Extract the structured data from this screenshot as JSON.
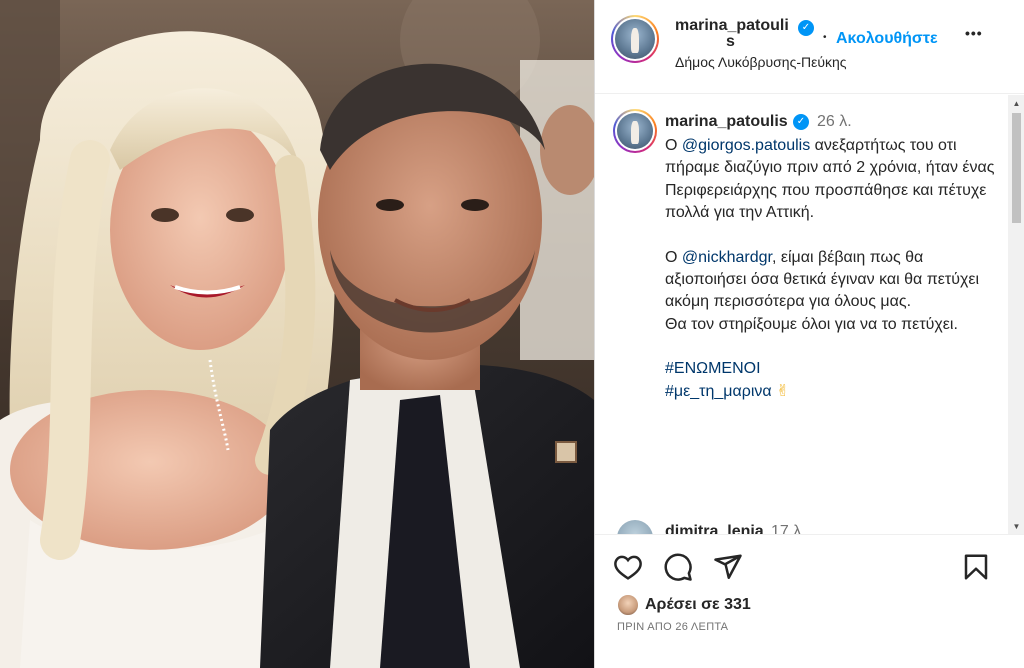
{
  "post": {
    "username": "marina_patoulis",
    "username_line1": "marina_patouli",
    "username_line2": "s",
    "verified_icon": "verified-badge-icon",
    "follow_label": "Ακολουθήστε",
    "separator": "•",
    "more_label": "•••",
    "location": "Δήμος Λυκόβρυσης-Πεύκης"
  },
  "caption": {
    "username": "marina_patoulis",
    "time": "26 λ.",
    "para1_prefix": "Ο ",
    "para1_mention": "@giorgos.patoulis",
    "para1_rest": " ανεξαρτήτως του οτι πήραμε διαζύγιο πριν από 2 χρόνια, ήταν ένας Περιφερειάρχης που προσπάθησε και πέτυχε πολλά για την Αττική.",
    "para2_prefix": "Ο ",
    "para2_mention": "@nickhardgr",
    "para2_rest": ", είμαι βέβαιη πως θα αξιοποιήσει όσα θετικά έγιναν και θα πετύχει ακόμη περισσότερα για όλους μας.",
    "para2_line2": "Θα τον στηρίξουμε όλοι για να το πετύχει.",
    "hashtag1": "#ΕΝΩΜΕΝΟΙ",
    "hashtag2": "#με_τη_μαρινα",
    "emoji": "✌"
  },
  "next_comment": {
    "username": "dimitra_lenia",
    "time": "17 λ."
  },
  "actions": {
    "like_icon": "heart-icon",
    "comment_icon": "comment-icon",
    "share_icon": "send-icon",
    "save_icon": "bookmark-icon",
    "likes_text": "Αρέσει σε 331",
    "post_time": "ΠΡΙΝ ΑΠΟ 26 ΛΕΠΤΑ"
  },
  "colors": {
    "accent": "#0095f6",
    "link": "#00376b",
    "muted": "#737373"
  }
}
